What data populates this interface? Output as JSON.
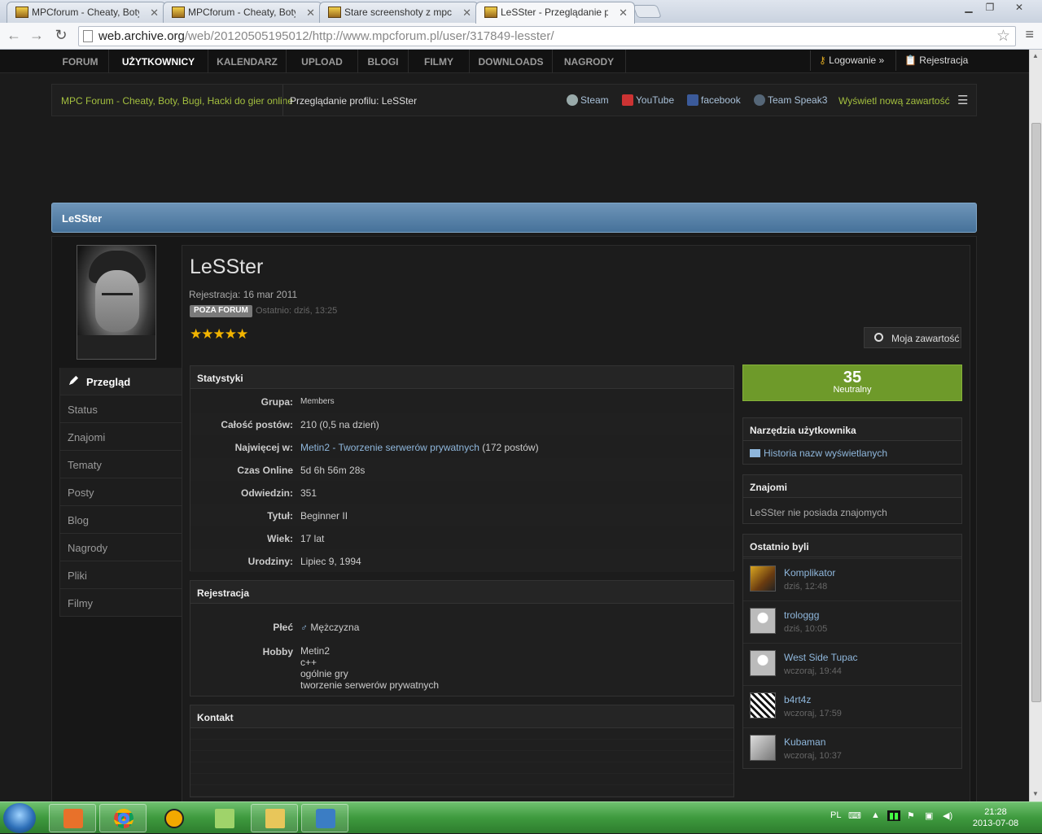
{
  "browser": {
    "tabs": [
      {
        "title": "MPCforum - Cheaty, Boty"
      },
      {
        "title": "MPCforum - Cheaty, Boty"
      },
      {
        "title": "Stare screenshoty z mpcfo"
      },
      {
        "title": "LeSSter - Przeglądanie pro"
      }
    ],
    "url_host": "web.archive.org",
    "url_path": "/web/20120505195012/http://www.mpcforum.pl/user/317849-lesster/"
  },
  "nav": {
    "items": [
      "FORUM",
      "UŻYTKOWNICY",
      "KALENDARZ",
      "UPLOAD",
      "BLOGI",
      "FILMY",
      "DOWNLOADS",
      "NAGRODY"
    ],
    "login": "Logowanie »",
    "register": "Rejestracja"
  },
  "breadcrumb": {
    "home": "MPC Forum - Cheaty, Boty, Bugi, Hacki do gier online",
    "current": "Przeglądanie profilu: LeSSter"
  },
  "social": {
    "steam": "Steam",
    "youtube": "YouTube",
    "facebook": "facebook",
    "teamspeak": "Team Speak3",
    "new_content": "Wyświetl nową zawartość"
  },
  "profile": {
    "header": "LeSSter",
    "name": "LeSSter",
    "registered": "Rejestracja: 16 mar 2011",
    "status_badge": "POZA FORUM",
    "last_seen": "Ostatnio: dziś, 13:25",
    "stars": "★★★★★",
    "my_content": "Moja zawartość"
  },
  "left_menu": [
    "Przegląd",
    "Status",
    "Znajomi",
    "Tematy",
    "Posty",
    "Blog",
    "Nagrody",
    "Pliki",
    "Filmy"
  ],
  "stats": {
    "title": "Statystyki",
    "rows": [
      {
        "k": "Grupa:",
        "v": "Members"
      },
      {
        "k": "Całość postów:",
        "v": "210 (0,5 na dzień)"
      },
      {
        "k": "Najwięcej w:",
        "v": "Metin2 - Tworzenie serwerów prywatnych",
        "v2": " (172 postów)"
      },
      {
        "k": "Czas Online",
        "v": "5d 6h 56m 28s"
      },
      {
        "k": "Odwiedzin:",
        "v": "351"
      },
      {
        "k": "Tytuł:",
        "v": "Beginner II"
      },
      {
        "k": "Wiek:",
        "v": "17 lat"
      },
      {
        "k": "Urodziny:",
        "v": "Lipiec 9, 1994"
      }
    ]
  },
  "registration": {
    "title": "Rejestracja",
    "gender_label": "Płeć",
    "gender_value": "Mężczyzna",
    "hobby_label": "Hobby",
    "hobby_lines": [
      "Metin2",
      "c++",
      "ogólnie gry",
      "tworzenie serwerów prywatnych"
    ]
  },
  "contact": {
    "title": "Kontakt"
  },
  "reputation": {
    "value": "35",
    "label": "Neutralny"
  },
  "tools": {
    "title": "Narzędzia użytkownika",
    "item": "Historia nazw wyświetlanych"
  },
  "friends": {
    "title": "Znajomi",
    "text": "LeSSter nie posiada znajomych"
  },
  "visitors": {
    "title": "Ostatnio byli",
    "list": [
      {
        "name": "Komplikator",
        "time": "dziś, 12:48"
      },
      {
        "name": "trologgg",
        "time": "dziś, 10:05"
      },
      {
        "name": "West Side Tupac",
        "time": "wczoraj, 19:44"
      },
      {
        "name": "b4rt4z",
        "time": "wczoraj, 17:59"
      },
      {
        "name": "Kubaman",
        "time": "wczoraj, 10:37"
      }
    ]
  },
  "taskbar": {
    "lang": "PL",
    "time": "21:28",
    "date": "2013-07-08"
  }
}
